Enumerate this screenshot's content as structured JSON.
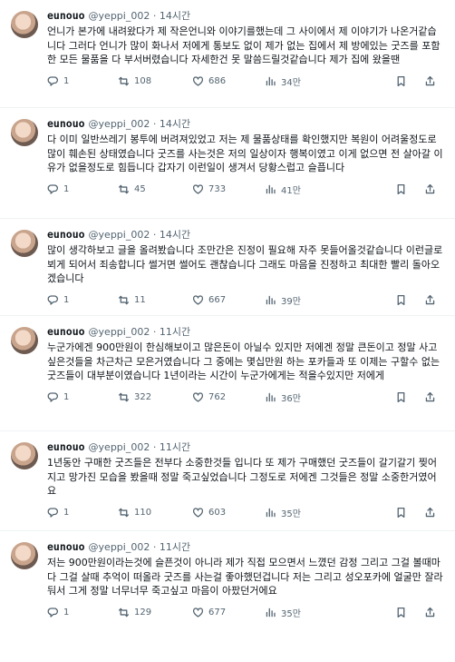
{
  "tweets": [
    {
      "name": "eunouo",
      "handle": "@yeppi_002",
      "time": "14시간",
      "text": "언니가 본가에 내려왔다가 제 작은언니와 이야기를했는데 그 사이에서 제 이야기가 나온거같습니다 그러다 언니가 많이 화나서 저에게 통보도 없이 제가 없는 집에서 제 방에있는 굿즈를 포함한 모든 물품을 다 부서버렸습니다 자세한건 못 말씀드릴것같습니다 제가 집에 왔을땐",
      "replies": "1",
      "retweets": "108",
      "likes": "686",
      "views": "34만"
    },
    {
      "name": "eunouo",
      "handle": "@yeppi_002",
      "time": "14시간",
      "text": "다 이미 일반쓰레기 봉투에 버려져있었고 저는 제 물품상태를 확인했지만 복원이 어려울정도로 많이 훼손된 상태였습니다 굿즈를 사는것은 저의 일상이자 행복이였고 이게 없으면 전 살아갈 이유가 없을정도로 힘듭니다 갑자기 이런일이 생겨서 당황스럽고 슬픕니다",
      "replies": "1",
      "retweets": "45",
      "likes": "733",
      "views": "41만"
    },
    {
      "name": "eunouo",
      "handle": "@yeppi_002",
      "time": "14시간",
      "text": "많이 생각하보고 글을 올려봤습니다 조만간은 진정이 필요해 자주 못들어올것같습니다 이런글로 뵈게 되어서 죄송합니다 썰거면 썰어도 괜찮습니다 그래도 마음을 진정하고 최대한 빨리 돌아오겠습니다",
      "replies": "1",
      "retweets": "11",
      "likes": "667",
      "views": "39만"
    },
    {
      "name": "eunouo",
      "handle": "@yeppi_002",
      "time": "11시간",
      "text": "누군가에겐 900만원이 한심해보이고 많은돈이 아닐수 있지만 저에겐 정말 큰돈이고 정말 사고싶은것들을 차근차근 모은거였습니다 그 중에는 몇십만원 하는 포카들과 또 이제는 구할수 없는 굿즈들이 대부분이였습니다 1년이라는 시간이 누군가에게는 적을수있지만 저에게",
      "replies": "1",
      "retweets": "322",
      "likes": "762",
      "views": "36만"
    },
    {
      "name": "eunouo",
      "handle": "@yeppi_002",
      "time": "11시간",
      "text": "1년동안 구매한 굿즈들은 전부다 소중한것들 입니다 또 제가 구매했던 굿즈들이 갈기갈기 찢어지고 망가진 모습을 봤을때 정말 죽고싶었습니다 그정도로 저에겐 그것들은 정말 소중한거였어요",
      "replies": "1",
      "retweets": "110",
      "likes": "603",
      "views": "35만"
    },
    {
      "name": "eunouo",
      "handle": "@yeppi_002",
      "time": "11시간",
      "text": "저는 900만원이라는것에 슬픈것이 아니라 제가 직접 모으면서 느꼈던 감정 그리고 그걸 볼때마다 그걸 살때 추억이 떠올라 굿즈를 사는걸 좋아했던겁니다 저는 그리고 성오포카에 얼굴만 잘라둬서 그게 정말 너무너무 죽고싶고 마음이 아팠던거에요",
      "replies": "1",
      "retweets": "129",
      "likes": "677",
      "views": "35만"
    }
  ]
}
